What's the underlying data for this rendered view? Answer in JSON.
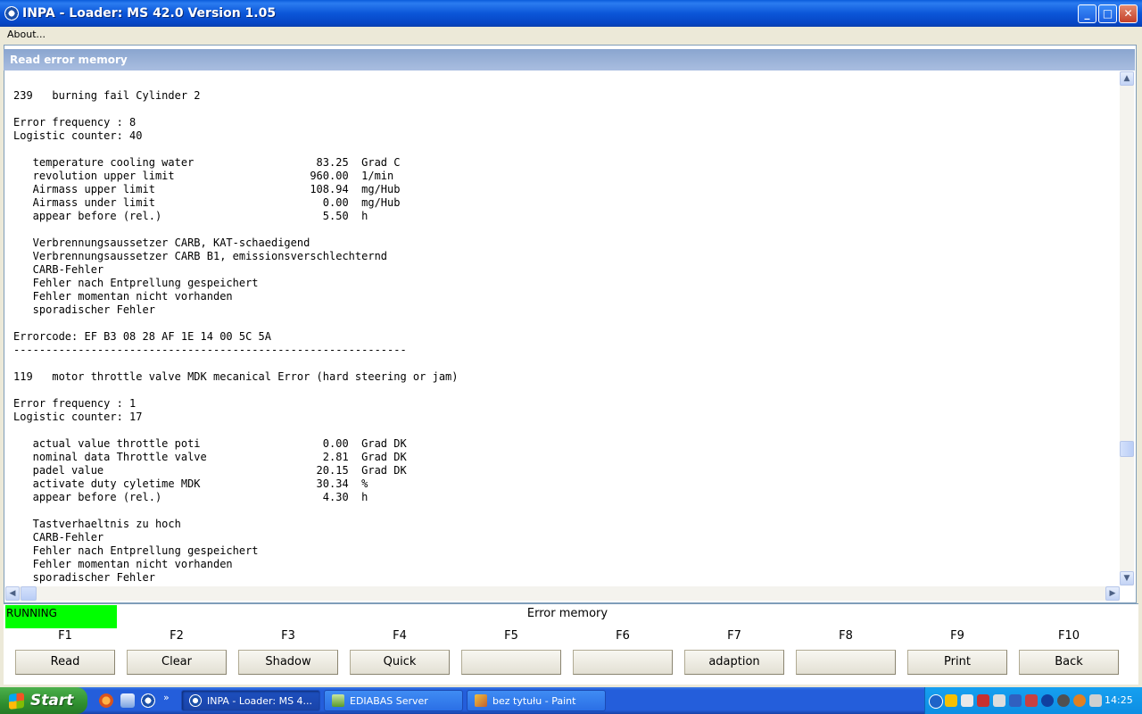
{
  "window": {
    "title": "INPA - Loader:  MS 42.0 Version 1.05",
    "min_symbol": "_",
    "max_symbol": "□",
    "close_symbol": "✕"
  },
  "menu": {
    "about": "About..."
  },
  "panel": {
    "title": "Read error memory"
  },
  "error_text": "239   burning fail Cylinder 2\n\nError frequency : 8\nLogistic counter: 40\n\n   temperature cooling water                   83.25  Grad C\n   revolution upper limit                     960.00  1/min\n   Airmass upper limit                        108.94  mg/Hub\n   Airmass under limit                          0.00  mg/Hub\n   appear before (rel.)                         5.50  h\n\n   Verbrennungsaussetzer CARB, KAT-schaedigend\n   Verbrennungsaussetzer CARB B1, emissionsverschlechternd\n   CARB-Fehler\n   Fehler nach Entprellung gespeichert\n   Fehler momentan nicht vorhanden\n   sporadischer Fehler\n\nErrorcode: EF B3 08 28 AF 1E 14 00 5C 5A\n-------------------------------------------------------------\n\n119   motor throttle valve MDK mecanical Error (hard steering or jam)\n\nError frequency : 1\nLogistic counter: 17\n\n   actual value throttle poti                   0.00  Grad DK\n   nominal data Throttle valve                  2.81  Grad DK\n   padel value                                 20.15  Grad DK\n   activate duty cyletime MDK                  30.34  %\n   appear before (rel.)                         4.30  h\n\n   Tastverhaeltnis zu hoch\n   CARB-Fehler\n   Fehler nach Entprellung gespeichert\n   Fehler momentan nicht vorhanden\n   sporadischer Fehler",
  "scroll": {
    "up": "▲",
    "down": "▼",
    "left": "◀",
    "right": "▶"
  },
  "status": {
    "state": "RUNNING",
    "state_color": "#00ff00",
    "title": "Error memory"
  },
  "fkeys": [
    {
      "key": "F1",
      "label": "Read"
    },
    {
      "key": "F2",
      "label": "Clear"
    },
    {
      "key": "F3",
      "label": "Shadow"
    },
    {
      "key": "F4",
      "label": "Quick"
    },
    {
      "key": "F5",
      "label": ""
    },
    {
      "key": "F6",
      "label": ""
    },
    {
      "key": "F7",
      "label": "adaption"
    },
    {
      "key": "F8",
      "label": ""
    },
    {
      "key": "F9",
      "label": "Print"
    },
    {
      "key": "F10",
      "label": "Back"
    }
  ],
  "taskbar": {
    "start": "Start",
    "more": "»",
    "tasks": [
      {
        "label": "INPA - Loader:  MS 4...",
        "icon": "bmw-icon"
      },
      {
        "label": "EDIABAS Server",
        "icon": "ediabas-icon"
      },
      {
        "label": "bez tytułu - Paint",
        "icon": "paint-icon"
      }
    ],
    "clock": "14:25"
  }
}
